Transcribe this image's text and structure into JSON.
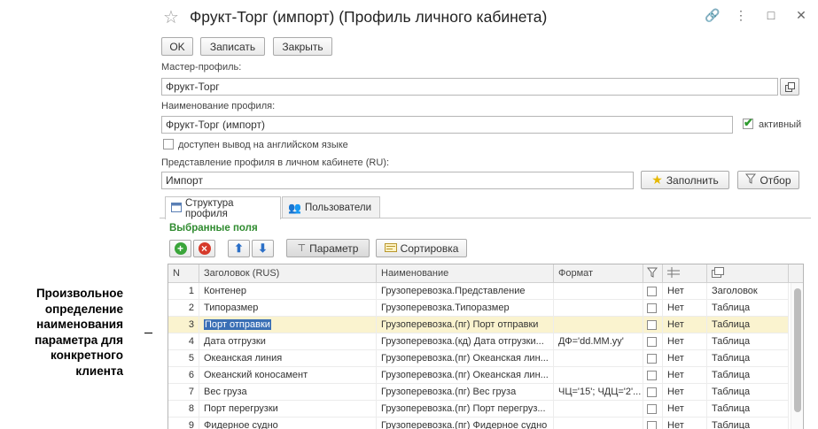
{
  "annotation": {
    "text": "Произвольное определение наименования параметра для конкретного клиента"
  },
  "window": {
    "title": "Фрукт-Торг (импорт) (Профиль личного кабинета)",
    "icons": [
      "link-icon",
      "more-icon",
      "maximize-icon",
      "close-icon"
    ]
  },
  "toolbar": {
    "ok_label": "OK",
    "save_label": "Записать",
    "close_label": "Закрыть"
  },
  "form": {
    "master_label": "Мастер-профиль:",
    "master_value": "Фрукт-Торг",
    "name_label": "Наименование профиля:",
    "name_value": "Фрукт-Торг (импорт)",
    "active_label": "активный",
    "active_checked": true,
    "english_label": "доступен вывод на английском языке",
    "english_checked": false,
    "repr_label": "Представление профиля в личном кабинете (RU):",
    "repr_value": "Импорт",
    "fill_label": "Заполнить",
    "filter_label": "Отбор"
  },
  "tabs": [
    {
      "label": "Структура профиля",
      "active": true
    },
    {
      "label": "Пользователи",
      "active": false
    }
  ],
  "section": {
    "title": "Выбранные поля",
    "param_label": "Параметр",
    "sort_label": "Сортировка"
  },
  "table": {
    "columns": [
      "N",
      "Заголовок (RUS)",
      "Наименование",
      "Формат"
    ],
    "rows": [
      {
        "n": "1",
        "title": "Контенер",
        "name": "Грузоперевозка.Представление",
        "format": "",
        "checked": false,
        "flag": "Нет",
        "type": "Заголовок",
        "selected": false
      },
      {
        "n": "2",
        "title": "Типоразмер",
        "name": "Грузоперевозка.Типоразмер",
        "format": "",
        "checked": false,
        "flag": "Нет",
        "type": "Таблица",
        "selected": false
      },
      {
        "n": "3",
        "title": "Порт отправки",
        "name": "Грузоперевозка.(пг) Порт отправки",
        "format": "",
        "checked": false,
        "flag": "Нет",
        "type": "Таблица",
        "selected": true
      },
      {
        "n": "4",
        "title": "Дата отгрузки",
        "name": "Грузоперевозка.(кд) Дата отгрузки...",
        "format": "ДФ='dd.MM.yy'",
        "checked": false,
        "flag": "Нет",
        "type": "Таблица",
        "selected": false
      },
      {
        "n": "5",
        "title": "Океанская линия",
        "name": "Грузоперевозка.(пг) Океанская лин...",
        "format": "",
        "checked": false,
        "flag": "Нет",
        "type": "Таблица",
        "selected": false
      },
      {
        "n": "6",
        "title": "Океанский коносамент",
        "name": "Грузоперевозка.(пг) Океанская лин...",
        "format": "",
        "checked": false,
        "flag": "Нет",
        "type": "Таблица",
        "selected": false
      },
      {
        "n": "7",
        "title": "Вес груза",
        "name": "Грузоперевозка.(пг) Вес груза",
        "format": "ЧЦ='15'; ЧДЦ='2'...",
        "checked": false,
        "flag": "Нет",
        "type": "Таблица",
        "selected": false
      },
      {
        "n": "8",
        "title": "Порт перегрузки",
        "name": "Грузоперевозка.(пг) Порт перегруз...",
        "format": "",
        "checked": false,
        "flag": "Нет",
        "type": "Таблица",
        "selected": false
      },
      {
        "n": "9",
        "title": "Фидерное судно",
        "name": "Грузоперевозка.(пг) Фидерное судно",
        "format": "",
        "checked": false,
        "flag": "Нет",
        "type": "Таблица",
        "selected": false
      }
    ]
  },
  "colors": {
    "accent_green": "#2f8b2f",
    "selection_row": "#faf3cf",
    "selection_text": "#3a6fb5"
  }
}
